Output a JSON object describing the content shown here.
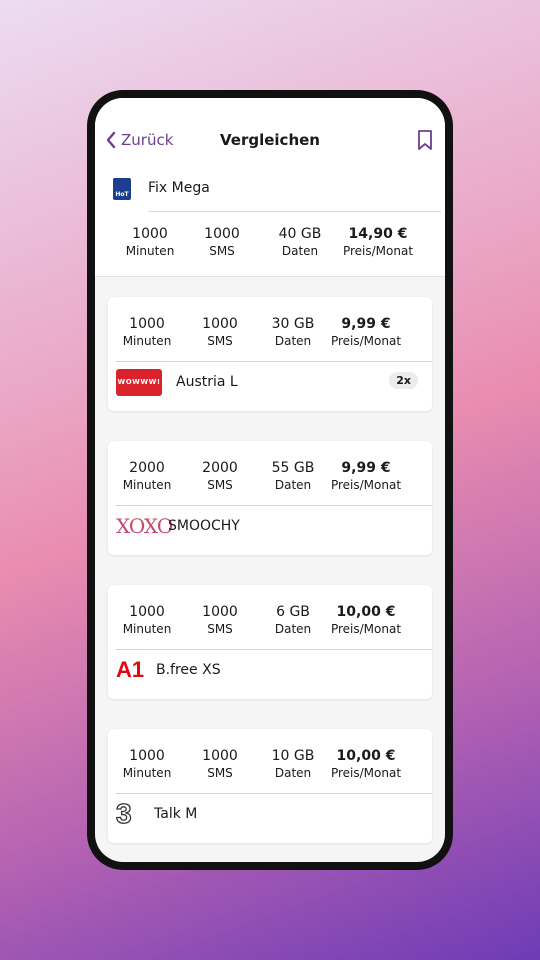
{
  "header": {
    "back_label": "Zurück",
    "title": "Vergleichen"
  },
  "selected": {
    "logo_text": "HoT",
    "name": "Fix Mega",
    "minutes": "1000",
    "minutes_label": "Minuten",
    "sms": "1000",
    "sms_label": "SMS",
    "data": "40 GB",
    "data_label": "Daten",
    "price": "14,90 €",
    "price_label": "Preis/Monat"
  },
  "offers": [
    {
      "minutes": "1000",
      "minutes_label": "Minuten",
      "sms": "1000",
      "sms_label": "SMS",
      "data": "30 GB",
      "data_label": "Daten",
      "price": "9,99 €",
      "price_label": "Preis/Monat",
      "logo_text": "WOWWW!",
      "name": "Austria L",
      "badge": "2x"
    },
    {
      "minutes": "2000",
      "minutes_label": "Minuten",
      "sms": "2000",
      "sms_label": "SMS",
      "data": "55 GB",
      "data_label": "Daten",
      "price": "9,99 €",
      "price_label": "Preis/Monat",
      "logo_text": "XOXO",
      "name": "SMOOCHY"
    },
    {
      "minutes": "1000",
      "minutes_label": "Minuten",
      "sms": "1000",
      "sms_label": "SMS",
      "data": "6 GB",
      "data_label": "Daten",
      "price": "10,00 €",
      "price_label": "Preis/Monat",
      "logo_text": "A1",
      "name": "B.free XS"
    },
    {
      "minutes": "1000",
      "minutes_label": "Minuten",
      "sms": "1000",
      "sms_label": "SMS",
      "data": "10 GB",
      "data_label": "Daten",
      "price": "10,00 €",
      "price_label": "Preis/Monat",
      "logo_text": "3",
      "name": "Talk M"
    }
  ],
  "colors": {
    "accent": "#6b3f8e"
  }
}
